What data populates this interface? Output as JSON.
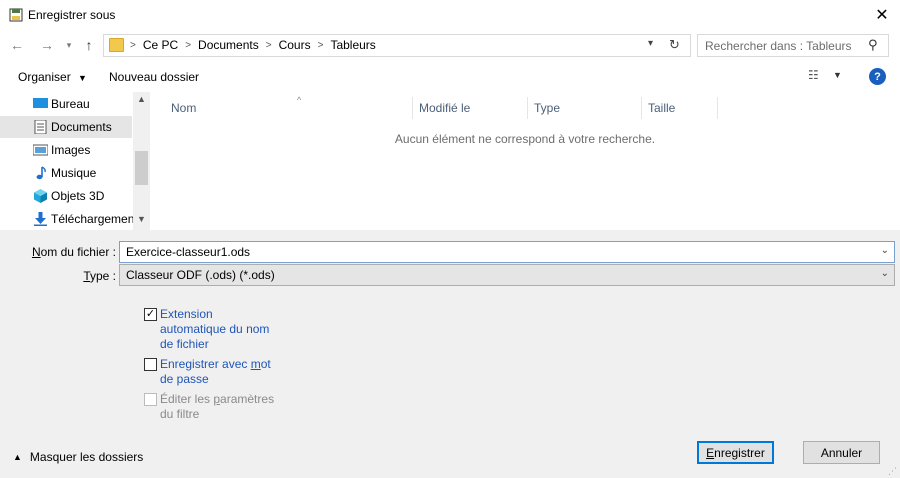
{
  "window": {
    "title": "Enregistrer sous"
  },
  "address": {
    "breadcrumbs": [
      "Ce PC",
      "Documents",
      "Cours",
      "Tableurs"
    ],
    "separator": ">"
  },
  "search": {
    "placeholder": "Rechercher dans : Tableurs"
  },
  "toolbar": {
    "organize": "Organiser",
    "new_folder": "Nouveau dossier"
  },
  "icons": {
    "back": "arrow-left-icon",
    "forward": "arrow-right-icon",
    "recent": "chevron-down-icon",
    "up": "arrow-up-icon",
    "refresh": "refresh-icon",
    "search": "search-icon",
    "view": "view-options-icon",
    "help": "help-icon",
    "close": "close-icon"
  },
  "sidebar": {
    "items": [
      {
        "label": "Bureau",
        "icon": "desktop-icon",
        "selected": false
      },
      {
        "label": "Documents",
        "icon": "documents-icon",
        "selected": true
      },
      {
        "label": "Images",
        "icon": "images-icon",
        "selected": false
      },
      {
        "label": "Musique",
        "icon": "music-icon",
        "selected": false
      },
      {
        "label": "Objets 3D",
        "icon": "objects-3d-icon",
        "selected": false
      },
      {
        "label": "Téléchargement",
        "icon": "download-icon",
        "selected": false
      }
    ]
  },
  "filelist": {
    "columns": [
      "Nom",
      "Modifié le",
      "Type",
      "Taille"
    ],
    "empty_message": "Aucun élément ne correspond à votre recherche."
  },
  "form": {
    "filename_label_first": "N",
    "filename_label_rest": "om du fichier :",
    "filename_value": "Exercice-classeur1.ods",
    "type_label_first": "T",
    "type_label_rest": "ype :",
    "type_value": "Classeur ODF (.ods) (*.ods)"
  },
  "options": {
    "auto_ext_label": "Extension automatique du nom de fichier",
    "auto_ext_checked": true,
    "password_label_part1": "Enregistrer avec ",
    "password_label_u": "m",
    "password_label_part2": "ot de passe",
    "password_checked": false,
    "filter_label_part1": "Éditer les ",
    "filter_label_u": "p",
    "filter_label_part2": "aramètres du filtre",
    "filter_checked": false,
    "filter_disabled": true
  },
  "footer": {
    "hide_folders": "Masquer les dossiers",
    "save_first": "E",
    "save_rest": "nregistrer",
    "cancel": "Annuler"
  },
  "colors": {
    "accent": "#0078d7",
    "link": "#1f55b7",
    "help_bg": "#1b5fbe",
    "folder": "#f2c94c"
  }
}
